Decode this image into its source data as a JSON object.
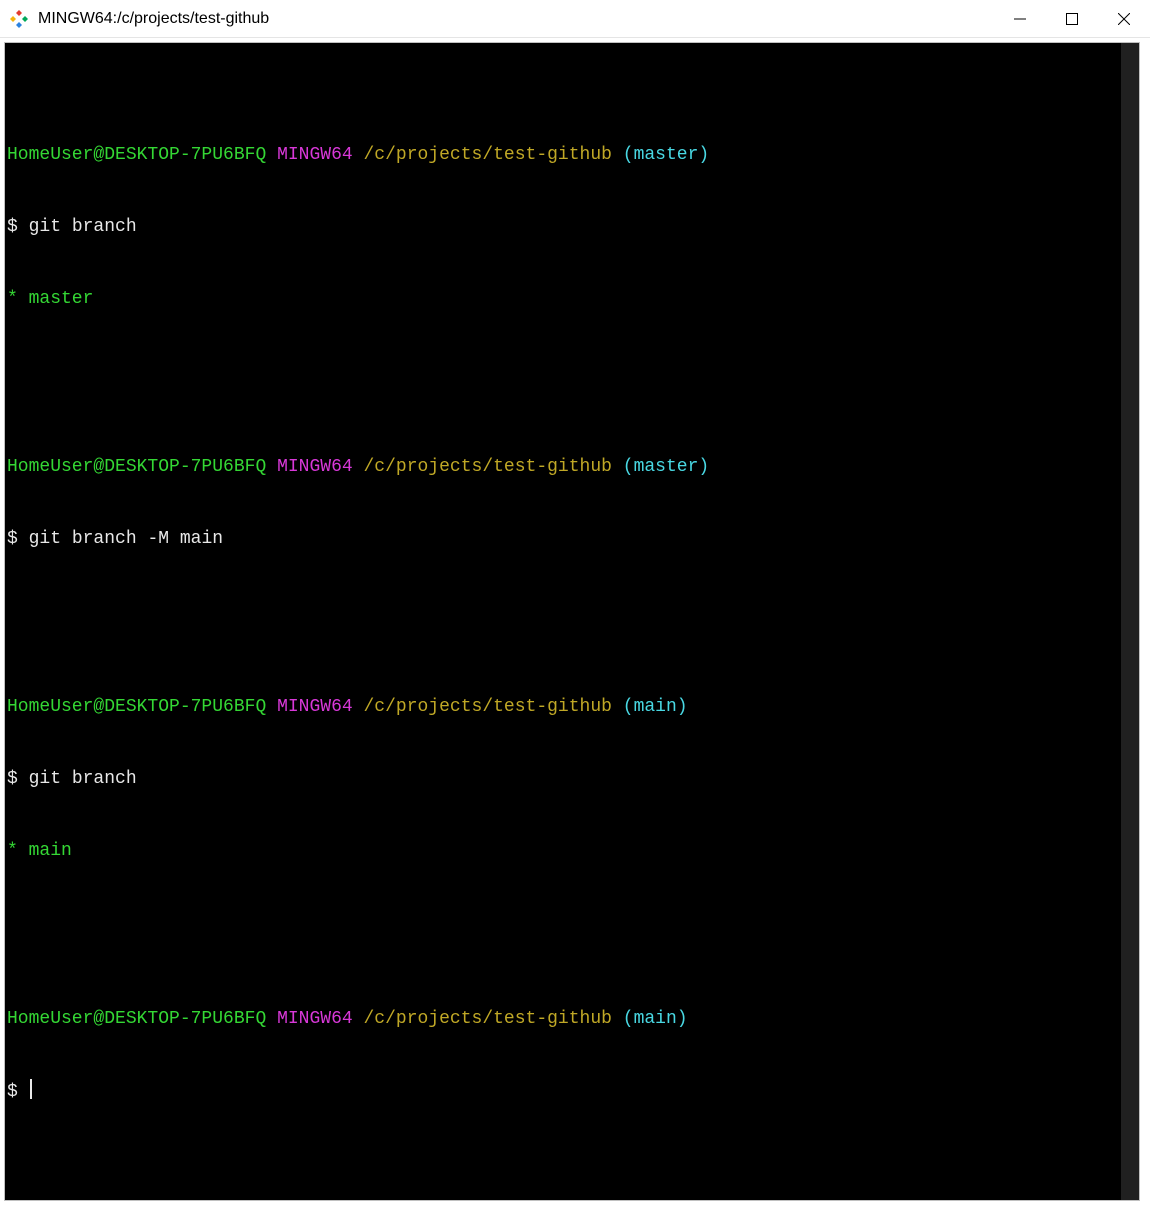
{
  "window": {
    "title": "MINGW64:/c/projects/test-github"
  },
  "prompt_parts": {
    "user_host": "HomeUser@DESKTOP-7PU6BFQ",
    "sys": "MINGW64",
    "path": "/c/projects/test-github",
    "branch_master": "(master)",
    "branch_main": "(main)",
    "dollar": "$"
  },
  "terminal": {
    "blocks": [
      {
        "branch_key": "branch_master",
        "command": "git branch",
        "output_selected": "* master"
      },
      {
        "branch_key": "branch_master",
        "command": "git branch -M main",
        "output_selected": ""
      },
      {
        "branch_key": "branch_main",
        "command": "git branch",
        "output_selected": "* main"
      },
      {
        "branch_key": "branch_main",
        "command": "",
        "output_selected": ""
      }
    ]
  }
}
